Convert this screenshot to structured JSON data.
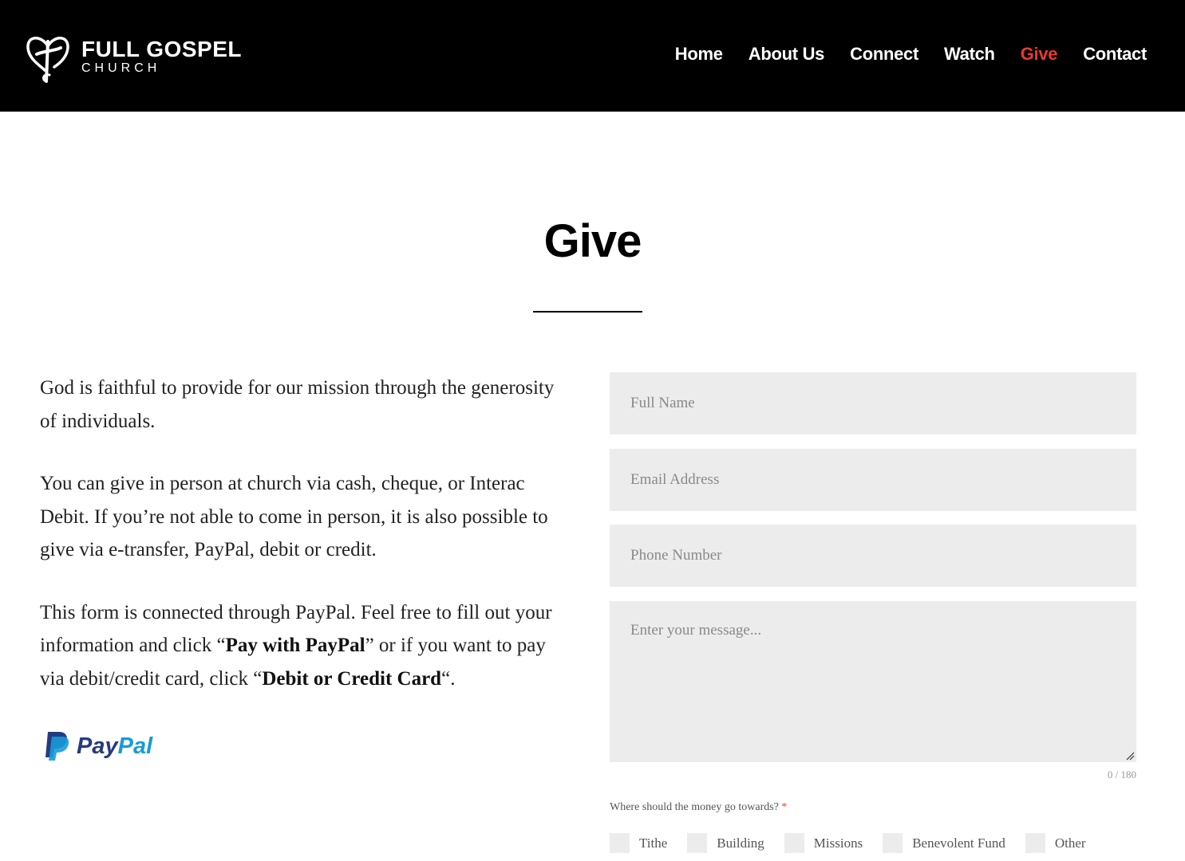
{
  "header": {
    "logo_line1": "FULL GOSPEL",
    "logo_line2": "CHURCH",
    "nav": [
      "Home",
      "About Us",
      "Connect",
      "Watch",
      "Give",
      "Contact"
    ],
    "active_nav": "Give",
    "active_color": "#e63b2e"
  },
  "page": {
    "title": "Give"
  },
  "intro": {
    "p1": "God is faithful to provide for our mission through the generosity of individuals.",
    "p2": "You can give in person at church via cash, cheque, or Interac Debit. If you’re not able to come in person, it is also possible to give via e-transfer, PayPal, debit or credit.",
    "p3_a": "This form is connected through PayPal. Feel free to fill out your information and click “",
    "p3_b": "Pay with PayPal",
    "p3_c": "” or if you want to pay via debit/credit card, click “",
    "p3_d": "Debit or Credit Card",
    "p3_e": "“.",
    "paypal_pay": "Pay",
    "paypal_pal": "Pal"
  },
  "form": {
    "name_placeholder": "Full Name",
    "email_placeholder": "Email Address",
    "phone_placeholder": "Phone Number",
    "message_placeholder": "Enter your message...",
    "counter": "0 / 180",
    "question": "Where should the money go towards?",
    "required_mark": "*",
    "options": [
      "Tithe",
      "Building",
      "Missions",
      "Benevolent Fund",
      "Other"
    ]
  }
}
